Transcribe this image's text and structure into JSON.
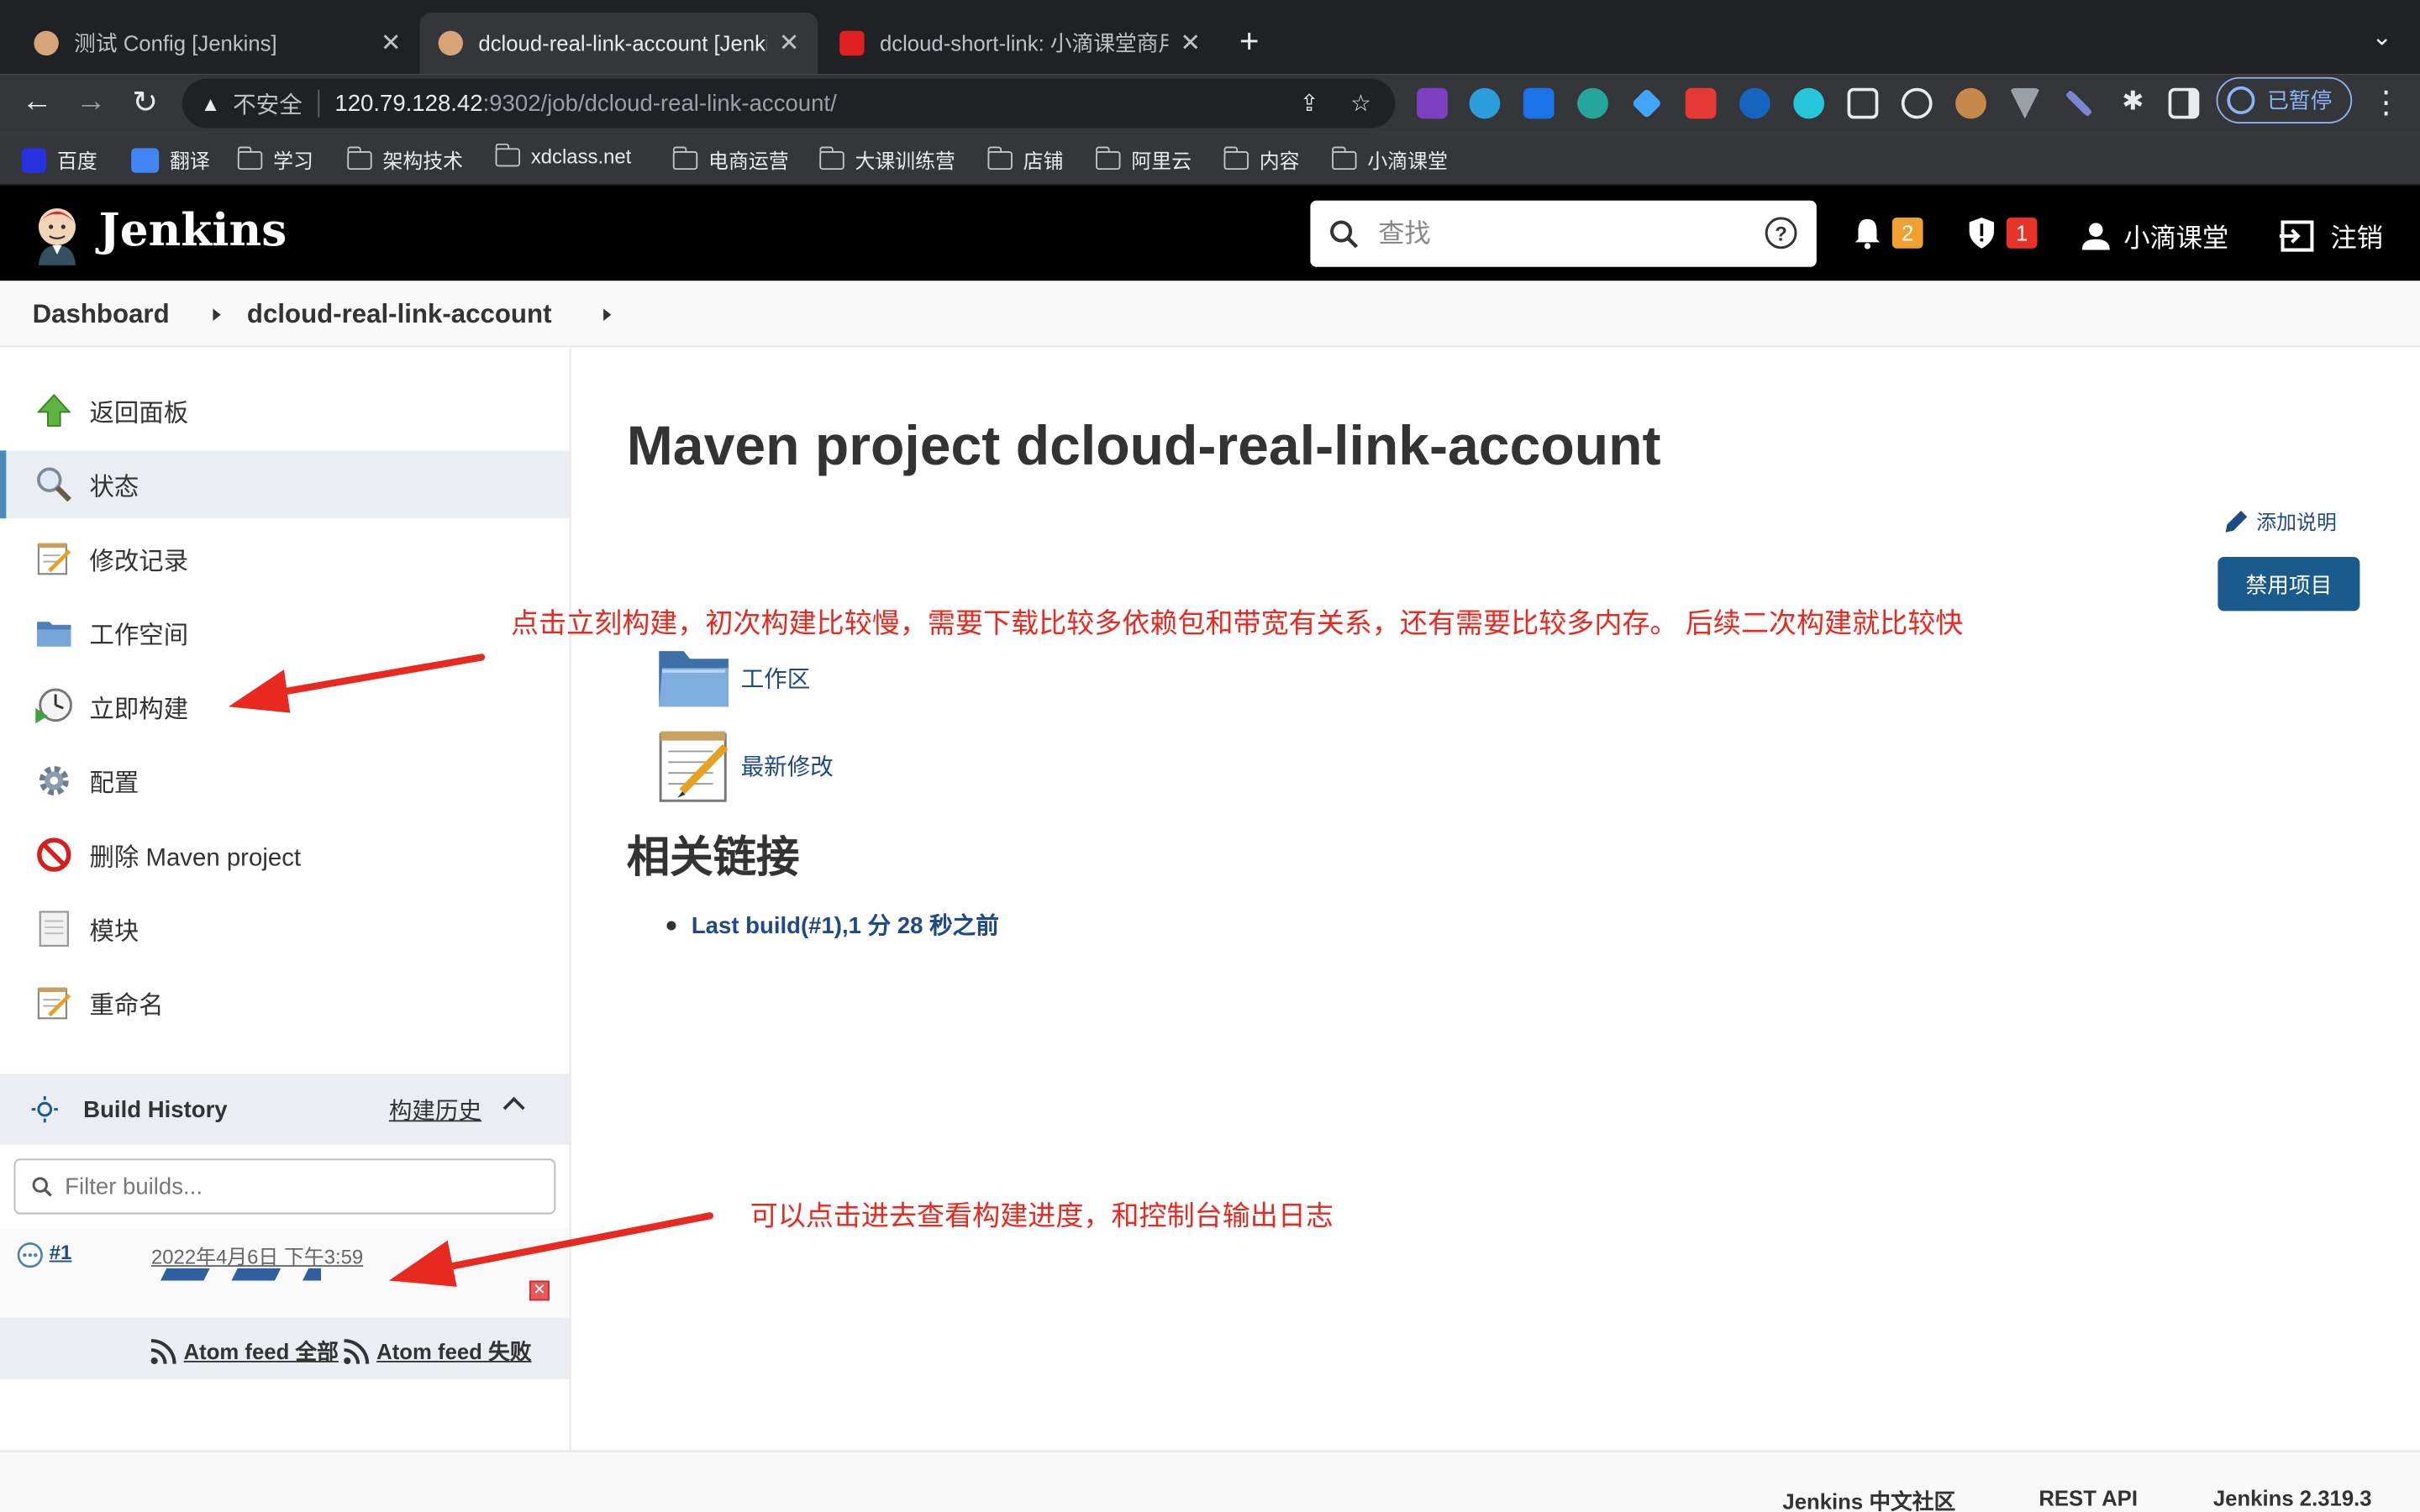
{
  "browser": {
    "tabs": [
      {
        "title": "测试 Config [Jenkins]"
      },
      {
        "title": "dcloud-real-link-account [Jenkins]"
      },
      {
        "title": "dcloud-short-link: 小滴课堂商用"
      }
    ],
    "url_warning": "不安全",
    "url_host": "120.79.128.42",
    "url_path": ":9302/job/dcloud-real-link-account/",
    "profile_label": "已暂停",
    "bookmarks": [
      "百度",
      "翻译",
      "学习",
      "架构技术",
      "xdclass.net",
      "电商运营",
      "大课训练营",
      "店铺",
      "阿里云",
      "内容",
      "小滴课堂"
    ]
  },
  "header": {
    "app_name": "Jenkins",
    "search_placeholder": "查找",
    "notifications_count": "2",
    "security_count": "1",
    "user_name": "小滴课堂",
    "logout_label": "注销",
    "colors": {
      "notif": "#f0a030",
      "security": "#e6332a"
    }
  },
  "breadcrumb": {
    "items": [
      "Dashboard",
      "dcloud-real-link-account"
    ]
  },
  "sidebar": {
    "items": [
      {
        "label": "返回面板",
        "icon": "up-arrow-icon"
      },
      {
        "label": "状态",
        "icon": "magnifier-icon"
      },
      {
        "label": "修改记录",
        "icon": "notepad-icon"
      },
      {
        "label": "工作空间",
        "icon": "folder-icon"
      },
      {
        "label": "立即构建",
        "icon": "clock-play-icon"
      },
      {
        "label": "配置",
        "icon": "gear-icon"
      },
      {
        "label": "删除 Maven project",
        "icon": "no-entry-icon"
      },
      {
        "label": "模块",
        "icon": "document-icon"
      },
      {
        "label": "重命名",
        "icon": "notepad-icon"
      }
    ],
    "active_index": 1
  },
  "build_history": {
    "title": "Build History",
    "trend_link": "构建历史",
    "filter_placeholder": "Filter builds...",
    "builds": [
      {
        "number": "#1",
        "date": "2022年4月6日 下午3:59"
      }
    ],
    "feed_all": "Atom feed 全部",
    "feed_failed": "Atom feed 失败"
  },
  "main": {
    "title": "Maven project dcloud-real-link-account",
    "add_description": "添加说明",
    "disable_button": "禁用项目",
    "links": [
      {
        "label": "工作区",
        "icon": "folder-icon"
      },
      {
        "label": "最新修改",
        "icon": "notepad-icon"
      }
    ],
    "related_title": "相关链接",
    "last_build": "Last build(#1),1 分 28 秒之前"
  },
  "annotations": {
    "top": "点击立刻构建，初次构建比较慢，需要下载比较多依赖包和带宽有关系，还有需要比较多内存。 后续二次构建就比较快",
    "bottom": "可以点击进去查看构建进度，和控制台输出日志",
    "color": "#e8291f"
  },
  "footer": {
    "community": "Jenkins 中文社区",
    "rest_api": "REST API",
    "version": "Jenkins 2.319.3"
  }
}
